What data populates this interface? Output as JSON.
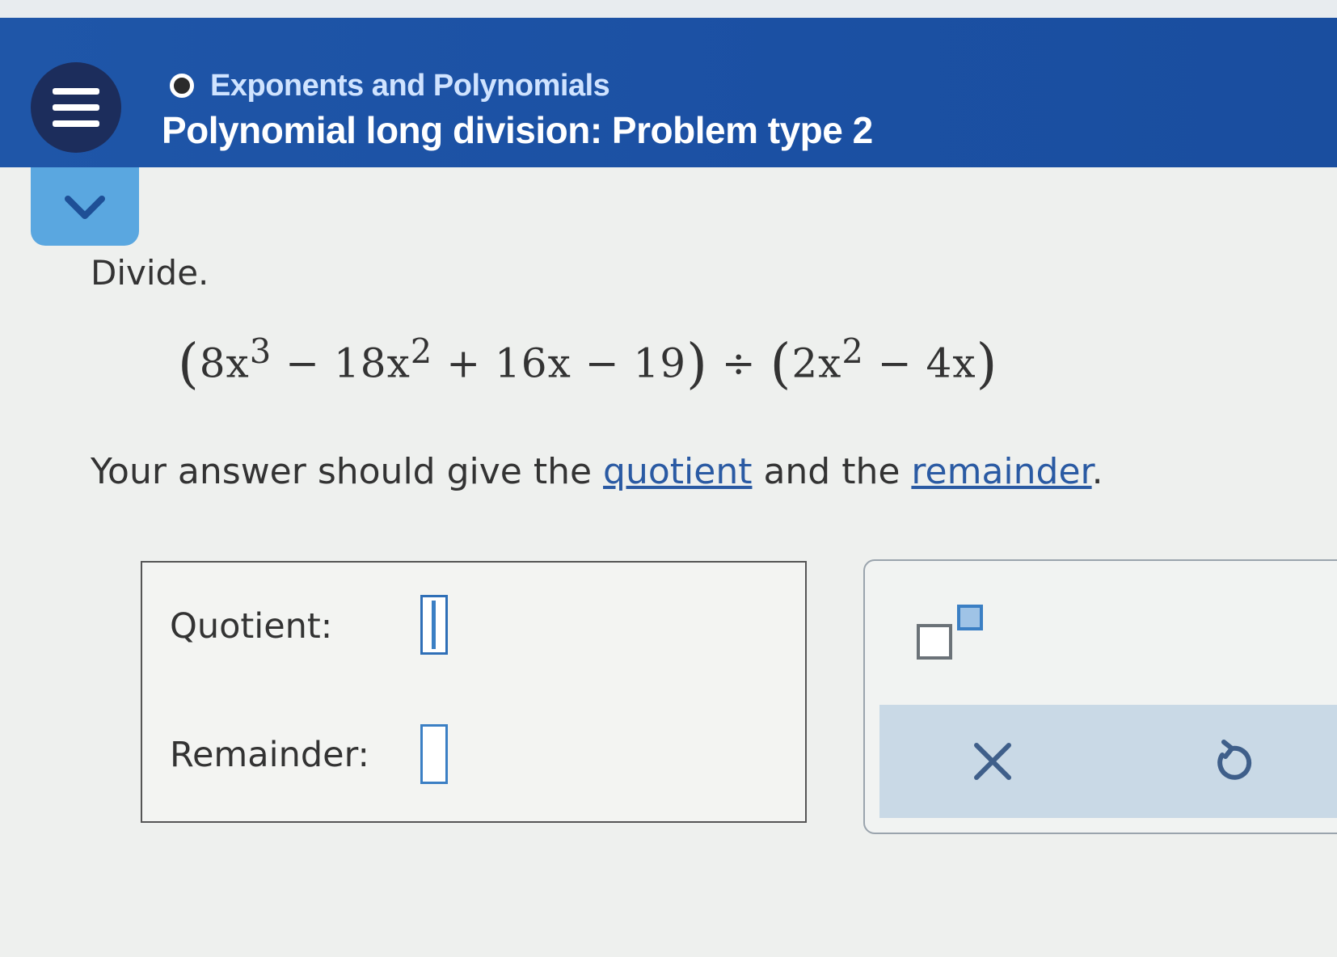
{
  "header": {
    "breadcrumb": "Exponents and Polynomials",
    "title": "Polynomial long division: Problem type 2",
    "menu_icon": "hamburger-menu-icon",
    "collapse_icon": "chevron-down-icon"
  },
  "problem": {
    "instruction": "Divide.",
    "expression": {
      "dividend": [
        "8x",
        "3",
        " − 18x",
        "2",
        " + 16x − 19"
      ],
      "operator": "÷",
      "divisor": [
        "2x",
        "2",
        " − 4x"
      ]
    },
    "answer_prompt": {
      "before": "Your answer should give the ",
      "link1": "quotient",
      "middle": " and the ",
      "link2": "remainder",
      "after": "."
    }
  },
  "answer": {
    "quotient_label": "Quotient:",
    "remainder_label": "Remainder:",
    "quotient_value": "",
    "remainder_value": ""
  },
  "tools": {
    "exponent_icon": "exponent-template-icon",
    "clear_icon": "clear-x-icon",
    "undo_icon": "undo-icon"
  },
  "colors": {
    "header_blue": "#1f56a8",
    "menu_button": "#1c2d5c",
    "breadcrumb_text": "#cfe3ff",
    "collapse_tab": "#5aa7e0",
    "link": "#2a5aa3",
    "input_border": "#3b7fc4",
    "tool_bar": "#c9d9e6"
  }
}
